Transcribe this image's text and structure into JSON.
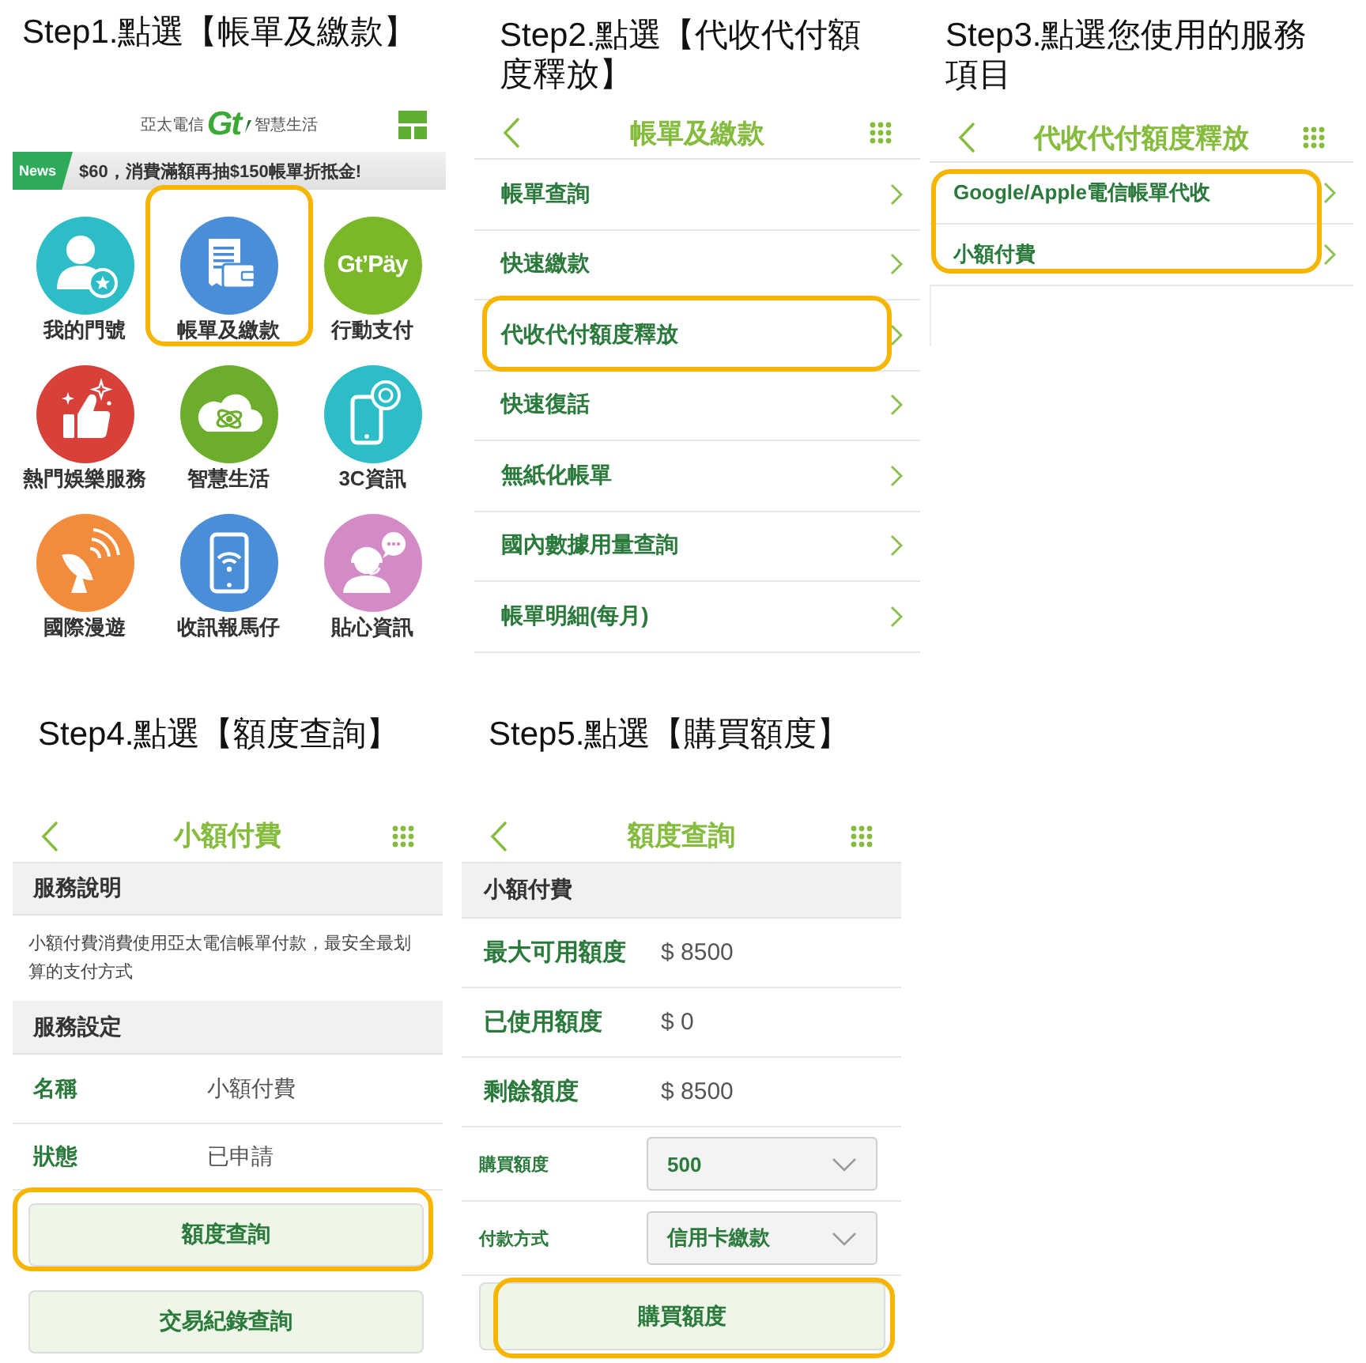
{
  "steps": [
    {
      "kind": "home",
      "title": "Step1.點選【帳單及繳款】",
      "logo": {
        "company": "亞太電信",
        "mark": "Gt",
        "tagline": "智慧生活"
      },
      "news": {
        "tag": "News",
        "text": "$60，消費滿額再抽$150帳單折抵金!"
      },
      "pay_logo": "Gt’Päy",
      "tiles": [
        {
          "kind": "account",
          "label": "我的門號",
          "color": "#2dbdc6",
          "highlighted": false
        },
        {
          "kind": "billing",
          "label": "帳單及繳款",
          "color": "#4a8ed8",
          "highlighted": true
        },
        {
          "kind": "pay",
          "label": "行動支付",
          "color": "#7ab829",
          "highlighted": false
        },
        {
          "kind": "entertainment",
          "label": "熱門娛樂服務",
          "color": "#d8413a",
          "highlighted": false
        },
        {
          "kind": "smart-life",
          "label": "智慧生活",
          "color": "#6cae2b",
          "highlighted": false
        },
        {
          "kind": "tech",
          "label": "3C資訊",
          "color": "#2dbdc6",
          "highlighted": false
        },
        {
          "kind": "roaming",
          "label": "國際漫遊",
          "color": "#f38b3d",
          "highlighted": false
        },
        {
          "kind": "signal",
          "label": "收訊報馬仔",
          "color": "#4a8ed8",
          "highlighted": false
        },
        {
          "kind": "support",
          "label": "貼心資訊",
          "color": "#d38bc8",
          "highlighted": false
        }
      ]
    },
    {
      "kind": "menu",
      "title": "Step2.點選【代收代付額度釋放】",
      "header": "帳單及繳款",
      "items": [
        {
          "label": "帳單查詢",
          "highlighted": false
        },
        {
          "label": "快速繳款",
          "highlighted": false
        },
        {
          "label": "代收代付額度釋放",
          "highlighted": true
        },
        {
          "label": "快速復話",
          "highlighted": false
        },
        {
          "label": "無紙化帳單",
          "highlighted": false
        },
        {
          "label": "國內數據用量查詢",
          "highlighted": false
        },
        {
          "label": "帳單明細(每月)",
          "highlighted": false
        }
      ]
    },
    {
      "kind": "menu",
      "title": "Step3.點選您使用的服務項目",
      "header": "代收代付額度釋放",
      "items": [
        {
          "label": "Google/Apple電信帳單代收",
          "highlighted": true
        },
        {
          "label": "小額付費",
          "highlighted": true
        }
      ]
    },
    {
      "kind": "service",
      "title": "Step4.點選【額度查詢】",
      "header": "小額付費",
      "description": {
        "heading": "服務說明",
        "text": "小額付費消費使用亞太電信帳單付款，最安全最划算的支付方式"
      },
      "settings": {
        "heading": "服務設定",
        "fields": [
          {
            "label": "名稱",
            "value": "小額付費"
          },
          {
            "label": "狀態",
            "value": "已申請"
          }
        ]
      },
      "buttons": [
        {
          "label": "額度查詢",
          "highlighted": true
        },
        {
          "label": "交易紀錄查詢",
          "highlighted": false
        }
      ]
    },
    {
      "kind": "quota",
      "title": "Step5.點選【購買額度】",
      "header": "額度查詢",
      "section": "小額付費",
      "fields": [
        {
          "label": "最大可用額度",
          "value": "$ 8500"
        },
        {
          "label": "已使用額度",
          "value": "$ 0"
        },
        {
          "label": "剩餘額度",
          "value": "$ 8500"
        }
      ],
      "selects": [
        {
          "label": "購買額度",
          "value": "500"
        },
        {
          "label": "付款方式",
          "value": "信用卡繳款"
        }
      ],
      "buttons": [
        {
          "label": "購買額度",
          "highlighted": true
        }
      ]
    }
  ]
}
